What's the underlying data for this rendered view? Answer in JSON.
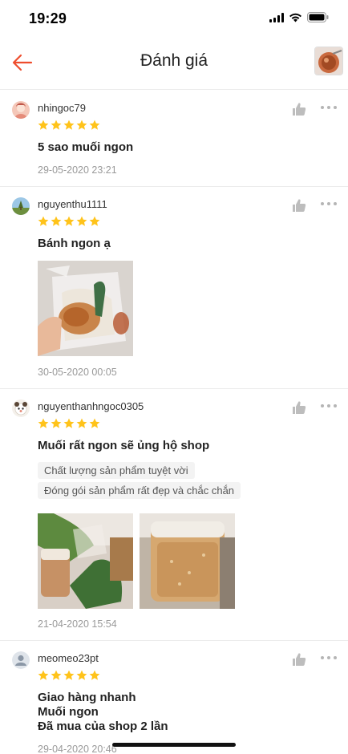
{
  "status_bar": {
    "time": "19:29",
    "icons": [
      "cellular-signal-icon",
      "wifi-icon",
      "battery-icon"
    ]
  },
  "header": {
    "back_icon": "arrow-left-icon",
    "title": "Đánh giá",
    "product_thumbnail": "product-thumbnail"
  },
  "colors": {
    "accent": "#ee4d2d",
    "star": "#ffc31a",
    "date": "#999999",
    "tag_bg": "#f3f3f3",
    "divider": "#ececec"
  },
  "reviews": [
    {
      "username": "nhingoc79",
      "rating": 5,
      "content_lines": [
        "5 sao muối ngon"
      ],
      "tags": [],
      "photos": [],
      "date": "29-05-2020 23:21"
    },
    {
      "username": "nguyenthu1111",
      "rating": 5,
      "content_lines": [
        "Bánh ngon ạ"
      ],
      "tags": [],
      "photos": [
        "review-photo-bag"
      ],
      "date": "30-05-2020 00:05"
    },
    {
      "username": "nguyenthanhngoc0305",
      "rating": 5,
      "content_lines": [
        "Muối rất ngon sẽ ủng hộ shop"
      ],
      "tags": [
        "Chất lượng sản phẩm tuyệt vời",
        "Đóng gói sản phẩm rất đẹp và chắc chắn"
      ],
      "photos": [
        "review-photo-package",
        "review-photo-jar"
      ],
      "date": "21-04-2020 15:54"
    },
    {
      "username": "meomeo23pt",
      "rating": 5,
      "content_lines": [
        "Giao hàng nhanh",
        "Muối ngon",
        "Đã mua của shop 2 lần"
      ],
      "tags": [],
      "photos": [],
      "date": "29-04-2020 20:46"
    }
  ]
}
